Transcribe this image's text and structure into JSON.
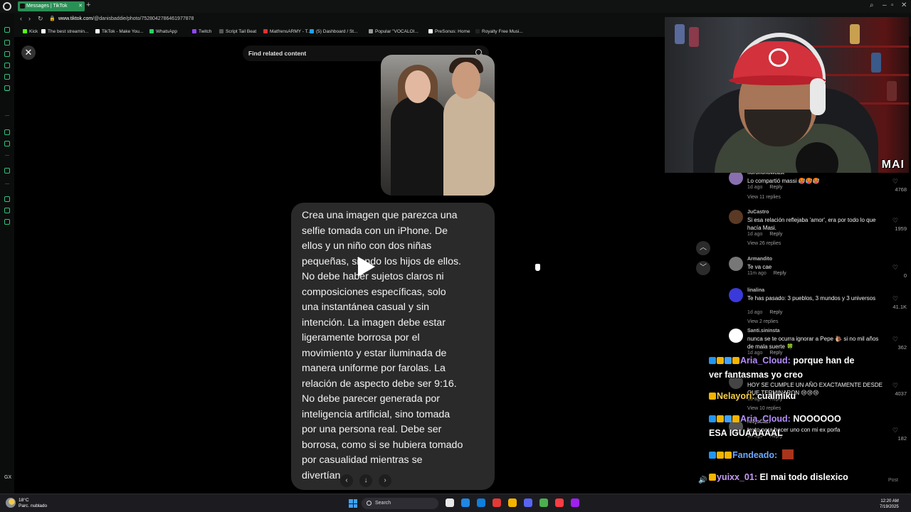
{
  "browser": {
    "tab_title": "Messages | TikTok",
    "url_host": "www.tiktok.com",
    "url_path": "/@danisbaddie/photo/7528042786461977878",
    "bookmarks": [
      {
        "label": "Kick",
        "color": "#53fc18"
      },
      {
        "label": "The best streamin...",
        "color": "#ffffff"
      },
      {
        "label": "TikTok - Make You...",
        "color": "#ffffff"
      },
      {
        "label": "WhatsApp",
        "color": "#25d366"
      },
      {
        "label": "Twitch",
        "color": "#9146ff"
      },
      {
        "label": "Script Tail Beat",
        "color": "#555555"
      },
      {
        "label": "MatfrensARMY - T...",
        "color": "#d33"
      },
      {
        "label": "(5) Dashboard / St...",
        "color": "#1da1f2"
      },
      {
        "label": "Popular \"VOCALOI...",
        "color": "#999999"
      },
      {
        "label": "PreSonus: Home",
        "color": "#ffffff"
      },
      {
        "label": "Royalty Free Musi...",
        "color": "#222222"
      }
    ]
  },
  "sidebar": {
    "items": [
      {
        "type": "icon",
        "name": "home-icon"
      },
      {
        "type": "icon",
        "name": "history-icon"
      },
      {
        "type": "icon",
        "name": "wallet-icon"
      },
      {
        "type": "icon",
        "name": "shop-icon"
      },
      {
        "type": "icon",
        "name": "messenger-icon"
      },
      {
        "type": "icon",
        "name": "whatsapp-icon"
      },
      {
        "type": "icon",
        "name": "tiktok-icon"
      },
      {
        "type": "icon",
        "name": "x-icon"
      },
      {
        "type": "icon",
        "name": "player-icon"
      },
      {
        "type": "icon",
        "name": "clock-icon"
      },
      {
        "type": "icon",
        "name": "box-icon"
      },
      {
        "type": "icon",
        "name": "settings-icon"
      }
    ],
    "footer_label": "GX"
  },
  "viewer": {
    "search_placeholder": "Find related content",
    "prompt_text": "Crea una imagen que parezca una\nselfie tomada con un iPhone. De\nellos y un niño con dos niñas\npequeñas, siendo los hijos de ellos.\nNo debe haber sujetos claros ni\ncomposiciones específicas, solo\nuna instantánea casual y sin\nintención. La imagen debe estar\nligeramente borrosa por el\nmovimiento y estar iluminada de\nmanera uniforme por farolas. La\nrelación de aspecto debe ser 9:16.\nNo debe parecer generada por\ninteligencia artificial, sino tomada\npor una persona real. Debe ser\nborrosa, como si se hubiera tomado\npor casualidad mientras se\ndivertían."
  },
  "comments": [
    {
      "user": "fiorononowcast",
      "text": "Lo compartió massi 🥵🥵🥵",
      "time": "1d ago",
      "reply": "Reply",
      "views": "View 11 replies",
      "likes": "4768",
      "avatar": "#8a6fb0"
    },
    {
      "user": "JuCastro",
      "text": "Si esa relación reflejaba 'amor', era por todo lo que hacía Masi.",
      "time": "1d ago",
      "reply": "Reply",
      "views": "View 26 replies",
      "likes": "1959",
      "avatar": "#5a3a24"
    },
    {
      "user": "Armandito",
      "text": "Te va cae",
      "time": "11m ago",
      "reply": "Reply",
      "views": "",
      "likes": "0",
      "avatar": "#777777"
    },
    {
      "user": "linalina",
      "text": "Te has pasado: 3 pueblos, 3 mundos y 3 universos",
      "time": "1d ago",
      "reply": "Reply",
      "views": "View 2 replies",
      "likes": "41.1K",
      "avatar": "#3a3adb"
    },
    {
      "user": "Santi.sininsta",
      "text": "nunca se te ocurra ignorar a Pepe 🐌 si no mil años de mala suerte 🍀",
      "time": "1d ago",
      "reply": "Reply",
      "views": "",
      "likes": "362",
      "avatar": "#ffffff"
    },
    {
      "user": "",
      "text": "HOY SE CUMPLE UN AÑO EXACTAMENTE DESDE QUE TERMINARON 😢😢😢",
      "time": "1d ago",
      "reply": "Reply",
      "views": "View 10 replies",
      "likes": "4037",
      "avatar": "#444444"
    },
    {
      "user": "AlejoCa27",
      "text": "texto para hacer uno con mi ex porfa",
      "time": "1d ago",
      "reply": "Reply",
      "views": "",
      "likes": "182",
      "avatar": "#555555"
    }
  ],
  "chat": [
    {
      "user": "Aria_Cloud:",
      "msg": "porque han de",
      "msg2": "ver fantasmas yo creo",
      "color": "user-purple"
    },
    {
      "user": "Nelayori:",
      "msg": "cualmiku",
      "color": "user-yellow"
    },
    {
      "user": "Aria_Cloud:",
      "msg": "NOOOOOO",
      "msg2": "ESA IGUAAAAAL",
      "color": "user-purple"
    },
    {
      "user": "Fandeado:",
      "msg": "",
      "color": "user-blue"
    },
    {
      "user": "yuixx_01:",
      "msg": "El mai todo dislexico",
      "color": "user-lav"
    }
  ],
  "webcam": {
    "watermark": "MAI"
  },
  "misc": {
    "post_label": "Post"
  },
  "taskbar": {
    "temperature": "18°C",
    "weather": "Parc. nublado",
    "search_label": "Search",
    "time": "12:20 AM",
    "date": "7/19/2025",
    "apps": [
      "#e8e8e8",
      "#1e88e5",
      "#0f7fdb",
      "#e53935",
      "#f4b400",
      "#5865f2",
      "#4caf50",
      "#fc3c44",
      "#a020f0"
    ]
  }
}
